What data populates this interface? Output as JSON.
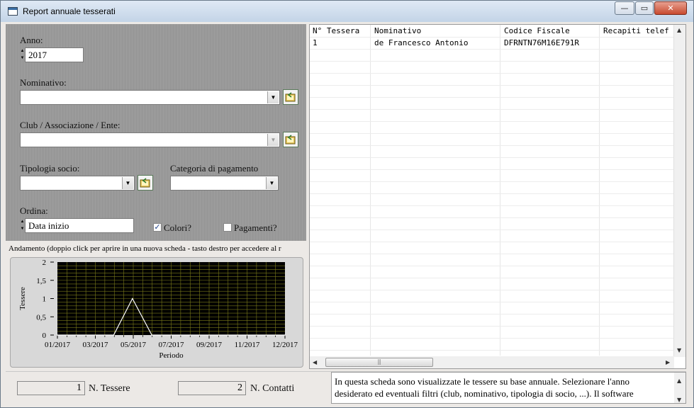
{
  "window": {
    "title": "Report annuale tesserati",
    "minimize_glyph": "—",
    "maximize_glyph": "▭",
    "close_glyph": "✕"
  },
  "filters": {
    "anno_label": "Anno:",
    "anno_value": "2017",
    "nominativo_label": "Nominativo:",
    "nominativo_value": "",
    "club_label": "Club / Associazione / Ente:",
    "club_value": "",
    "tipologia_label": "Tipologia socio:",
    "tipologia_value": "",
    "categoria_label": "Categoria di pagamento",
    "categoria_value": "",
    "ordina_label": "Ordina:",
    "ordina_value": "Data inizio",
    "colori_label": "Colori?",
    "colori_checked": true,
    "pagamenti_label": "Pagamenti?",
    "pagamenti_checked": false,
    "icons": {
      "spinner": "spinner-arrows-icon",
      "dropdown": "chevron-down-icon",
      "browse": "folder-browse-icon",
      "check": "checkmark-icon"
    }
  },
  "chart": {
    "caption": "Andamento (doppio click per aprire in una nuova scheda - tasto destro per accedere al r",
    "colors": {
      "plot_bg": "#000000",
      "grid": "#7a7a1a",
      "line": "#ffffff",
      "panel": "#d8d8d8"
    }
  },
  "chart_data": {
    "type": "line",
    "title": "",
    "xlabel": "Periodo",
    "ylabel": "Tessere",
    "x_ticks": [
      "01/2017",
      "03/2017",
      "05/2017",
      "07/2017",
      "09/2017",
      "11/2017",
      "12/2017"
    ],
    "y_ticks": [
      "0",
      "0,5",
      "1",
      "1,5",
      "2"
    ],
    "ylim": [
      0,
      2
    ],
    "xlim": [
      "2017-01-01",
      "2017-12-31"
    ],
    "grid": true,
    "series": [
      {
        "x": [
          "2017-01-01",
          "2017-04-01",
          "2017-05-01",
          "2017-06-01",
          "2017-12-31"
        ],
        "y": [
          0,
          0,
          1,
          0,
          0
        ]
      }
    ]
  },
  "table": {
    "columns": [
      "N° Tessera",
      "Nominativo",
      "Codice Fiscale",
      "Recapiti telef"
    ],
    "rows": [
      [
        "1",
        "de Francesco Antonio",
        "DFRNTN76M16E791R",
        ""
      ]
    ],
    "scroll": {
      "up": "▲",
      "down": "▼",
      "left": "◀",
      "right": "▶",
      "thumb_grip": "|||"
    }
  },
  "footer": {
    "tessere_count": "1",
    "tessere_label": "N. Tessere",
    "contatti_count": "2",
    "contatti_label": "N. Contatti",
    "info_text": "In questa scheda sono visualizzate le tessere su base annuale. Selezionare l'anno desiderato ed eventuali filtri (club, nominativo, tipologia di socio, ...).  Il software",
    "info_scroll": {
      "up": "▲",
      "down": "▼"
    }
  }
}
